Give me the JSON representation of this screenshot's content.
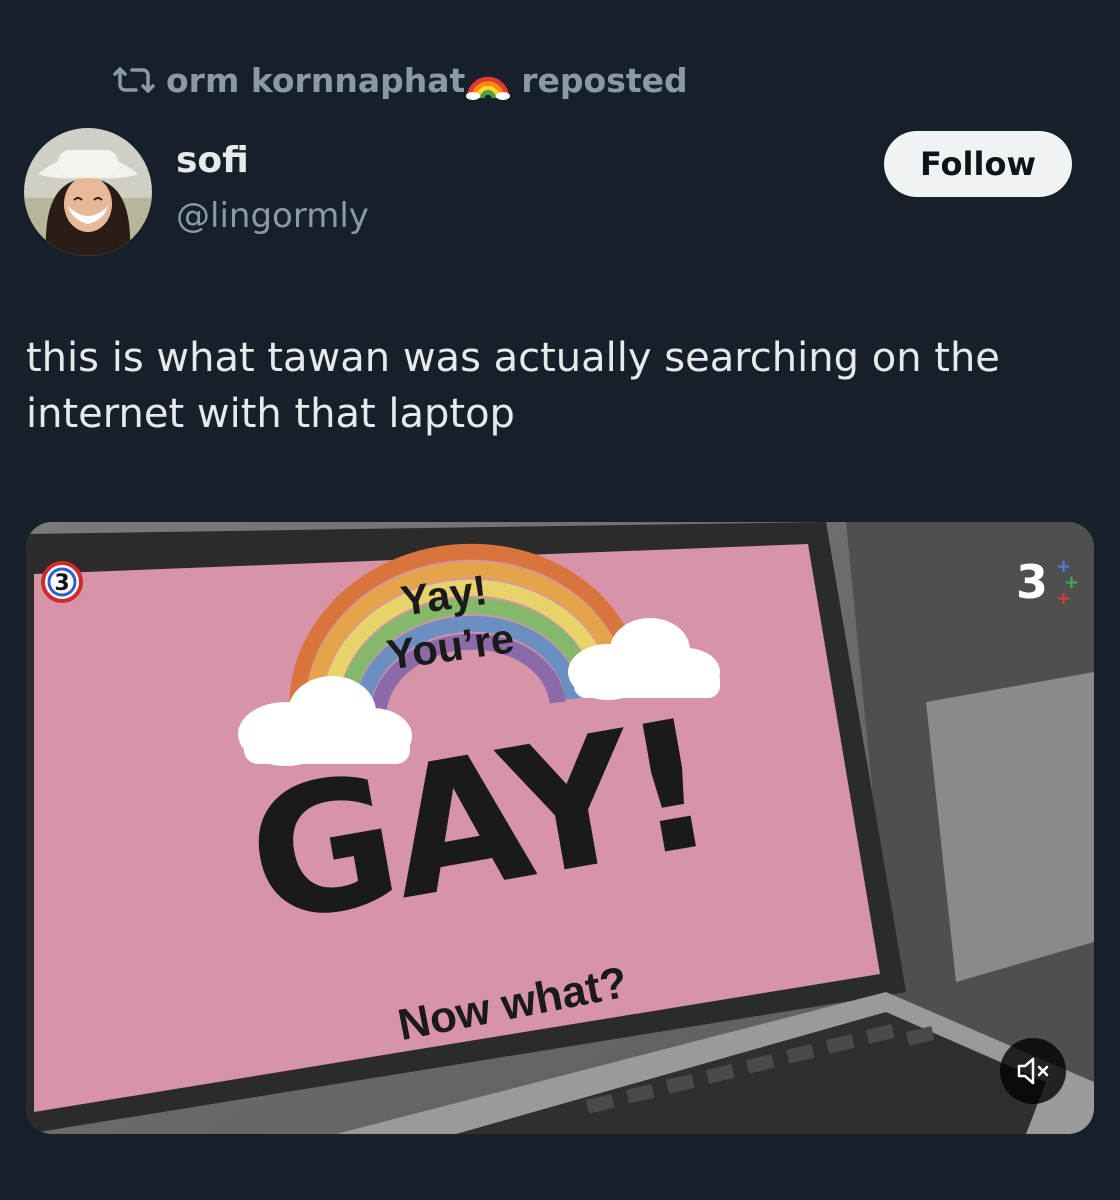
{
  "repost": {
    "reposter_name": "orm kornnaphat",
    "label": "reposted",
    "icons": [
      "repost-icon",
      "rainbow-emoji"
    ]
  },
  "author": {
    "display_name": "sofi",
    "handle": "@lingormly",
    "follow_label": "Follow"
  },
  "tweet": {
    "text": "this is what tawan was actually searching on the internet with that laptop"
  },
  "media": {
    "type": "video",
    "screen_text": {
      "line1": "Yay!",
      "line2": "You’re",
      "headline": "GAY!",
      "footer": "Now what?"
    },
    "overlay_icons": [
      "channel-3-logo",
      "channel-3-plus-logo",
      "mute-icon"
    ],
    "screen_color": "#d793a8"
  },
  "colors": {
    "background": "#15202b",
    "secondary_text": "#8b98a5",
    "primary_text": "#e7e9ea",
    "follow_button_bg": "#eff3f4"
  }
}
